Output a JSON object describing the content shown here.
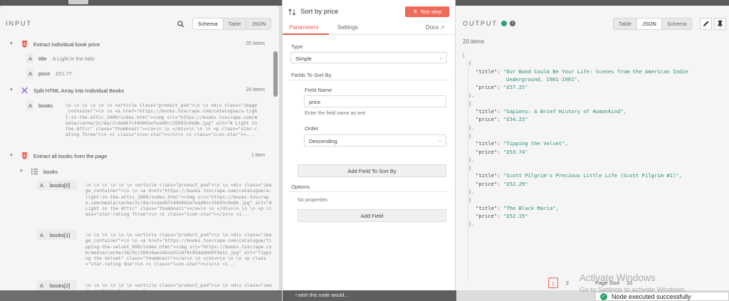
{
  "input": {
    "heading": "INPUT",
    "view_tabs": [
      "Schema",
      "Table",
      "JSON"
    ],
    "active_tab": "Schema",
    "nodes": [
      {
        "title": "Extract individual book price",
        "count": "20 items",
        "fields": [
          {
            "type": "A",
            "name": "title",
            "value": "A Light in the Attic"
          },
          {
            "type": "A",
            "name": "price",
            "value": "£51.77"
          }
        ]
      },
      {
        "title": "Split HTML Array into Individual Books",
        "count": "20 items",
        "fields": [
          {
            "type": "A",
            "name": "books",
            "value": "\\n \\n \\n \\n \\n \\n <article class=\"product_pod\">\\n \\n <div class=\"image_container\">\\n \\n <a href=\"https://books.toscrape.com/catalogue/a-light-in-the-attic_1000/index.html\"><img src=\"https://books.toscrape.com/media/cache/2c/da/2cdad67c44b002e7ead0cc35693c0e8b.jpg\" alt=\"A Light in the Attic\" class=\"thumbnail\"></a>\\n \\n </div>\\n \\n \\n <p class=\"star-rating Three\">\\n <i class=\"icon-star\"></i>\\n <i class=\"icon-star\"><..."
          }
        ]
      },
      {
        "title": "Extract all books from the page",
        "count": "1 item",
        "array_name": "books",
        "items": [
          {
            "type": "A",
            "name": "books[0]",
            "value": "\\n \\n \\n \\n \\n \\n <article class=\"product_pod\">\\n \\n <div class=\"image_container\">\\n \\n <a href=\"https://books.toscrape.com/catalogue/a-light-in-the-attic_1000/index.html\"><img src=\"https://books.toscrape.com/media/cache/2c/da/2cdad67c44b002e7ead0cc35693c0e8b.jpg\" alt=\"A Light in the Attic\" class=\"thumbnail\"></a>\\n \\n </div>\\n \\n \\n <p class=\"star-rating Three\">\\n <i class=\"icon-star\"></i>\\n <i..."
          },
          {
            "type": "A",
            "name": "books[1]",
            "value": "\\n \\n \\n \\n \\n \\n <article class=\"product_pod\">\\n \\n <div class=\"image_container\">\\n \\n <a href=\"https://books.toscrape.com/catalogue/tipping-the-velvet_999/index.html\"><img src=\"https://books.toscrape.com/media/cache/26/0c/260c6ae16bce31c8f8c95daddd9f4a1c.jpg\" alt=\"Tipping the Velvet\" class=\"thumbnail\"></a>\\n \\n </div>\\n \\n \\n <p class=\"star-rating One\">\\n <i class=\"icon-star\"></i>\\n <i..."
          },
          {
            "type": "A",
            "name": "books[2]",
            "value": "\\n \\n \\n \\n \\n \\n <article class=\"product_pod\">\\n \\n <div class=\"image_container\">\\n \\n <a"
          }
        ]
      }
    ]
  },
  "modal": {
    "title": "Sort by price",
    "test_button": "Test step",
    "tabs": {
      "parameters": "Parameters",
      "settings": "Settings",
      "docs": "Docs"
    },
    "type_label": "Type",
    "type_value": "Simple",
    "fields_to_sort_label": "Fields To Sort By",
    "field_name_label": "Field Name",
    "field_name_value": "price",
    "field_name_hint": "Enter the field name as text",
    "order_label": "Order",
    "order_value": "Descending",
    "add_sort_field_button": "Add Field To Sort By",
    "options_label": "Options",
    "no_properties": "No properties",
    "add_field_button": "Add Field",
    "footer_text": "I wish this node would..."
  },
  "output": {
    "heading": "OUTPUT",
    "item_count": "20 items",
    "view_tabs": [
      "Table",
      "JSON",
      "Schema"
    ],
    "active_tab": "JSON",
    "json_open": "[",
    "records": [
      {
        "title_line1": "\"Our Band Could Be Your Life: Scenes from the American Indie",
        "title_line2": "Underground, 1981-1991\",",
        "price": "\"£57.25\""
      },
      {
        "title_line1": "\"Sapiens: A Brief History of Humankind\",",
        "title_line2": "",
        "price": "\"£54.23\""
      },
      {
        "title_line1": "\"Tipping the Velvet\",",
        "title_line2": "",
        "price": "\"£53.74\""
      },
      {
        "title_line1": "\"Scott Pilgrim's Precious Little Life (Scott Pilgrim #1)\",",
        "title_line2": "",
        "price": "\"£52.29\""
      },
      {
        "title_line1": "\"The Black Maria\",",
        "title_line2": "",
        "price": "\"£52.15\""
      }
    ],
    "title_key": "\"title\":",
    "price_key": "\"price\":",
    "pagination": {
      "pages": [
        "1",
        "2"
      ],
      "active": "1",
      "page_size_label": "Page Size",
      "page_size_value": "10"
    }
  },
  "watermark": {
    "line1": "Activate Windows",
    "line2": "Go to Settings to activate Windows."
  },
  "toast": {
    "message": "Node executed successfully"
  },
  "colors": {
    "accent": "#e8604d",
    "success": "#2aa36b",
    "test_button": "#ee6a59"
  },
  "icons": [
    "search-icon",
    "chevron-down-icon",
    "html-node-icon",
    "sort-icon",
    "external-link-icon",
    "check-circle-icon",
    "info-icon",
    "pencil-icon",
    "pin-icon",
    "array-list-icon"
  ]
}
